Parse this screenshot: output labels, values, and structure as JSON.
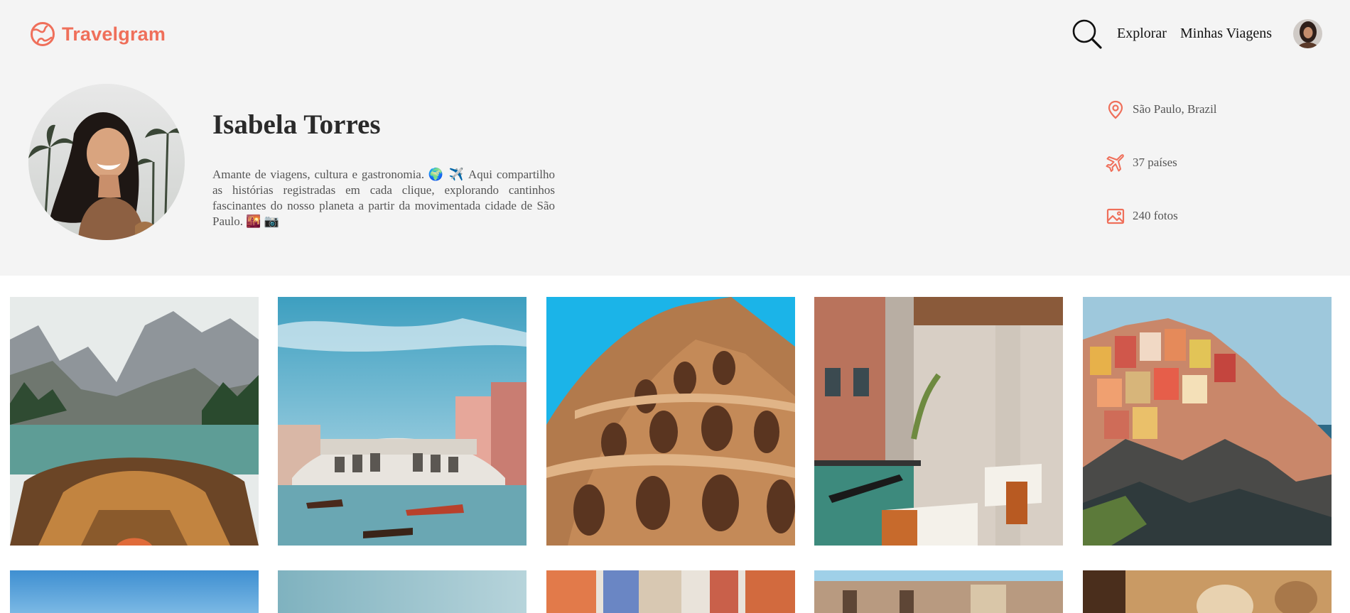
{
  "brand": {
    "name": "Travelgram",
    "icon": "globe-icon",
    "color": "#ef6f5a"
  },
  "nav": {
    "search_icon": "search-icon",
    "explore_label": "Explorar",
    "trips_label": "Minhas Viagens",
    "avatar": "user-avatar"
  },
  "profile": {
    "name": "Isabela Torres",
    "bio": "Amante de viagens, cultura e gastronomia. 🌍 ✈️ Aqui compartilho as histórias registradas em cada clique, explorando cantinhos fascinantes do nosso planeta a partir da movimentada cidade de São Paulo. 🌇 📷"
  },
  "stats": [
    {
      "icon": "location-pin-icon",
      "text": "São Paulo, Brazil"
    },
    {
      "icon": "airplane-icon",
      "text": "37 países"
    },
    {
      "icon": "image-icon",
      "text": "240 fotos"
    }
  ],
  "gallery": [
    {
      "name": "photo-mountain-lake-boat"
    },
    {
      "name": "photo-venice-rialto-bridge"
    },
    {
      "name": "photo-colosseum"
    },
    {
      "name": "photo-venice-canal-restaurant"
    },
    {
      "name": "photo-cinque-terre"
    },
    {
      "name": "photo-row2-sky"
    },
    {
      "name": "photo-row2-sea"
    },
    {
      "name": "photo-row2-street"
    },
    {
      "name": "photo-row2-building"
    },
    {
      "name": "photo-row2-food"
    }
  ],
  "colors": {
    "accent": "#ef6f5a",
    "header_bg": "#f4f4f4"
  }
}
